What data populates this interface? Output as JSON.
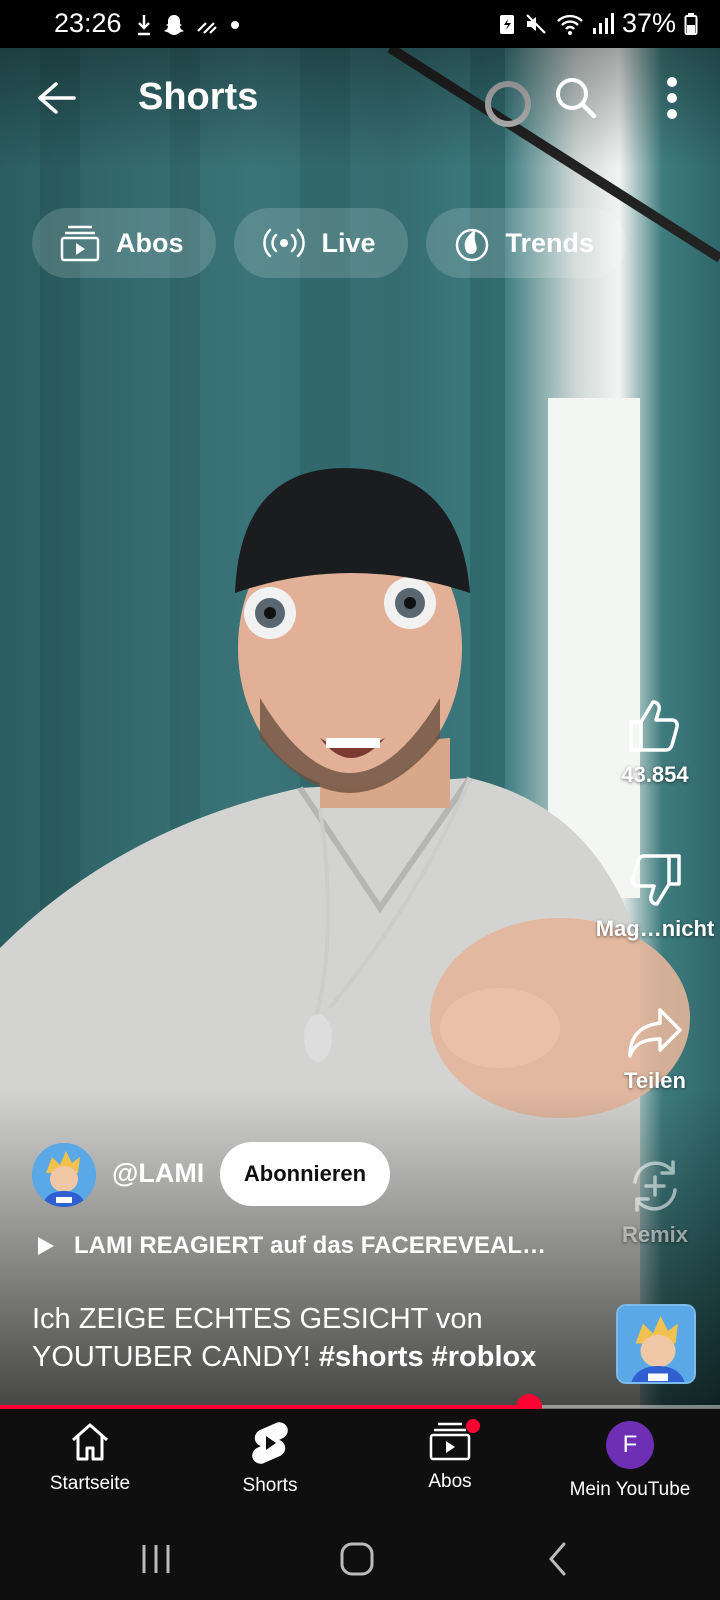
{
  "status_bar": {
    "time": "23:26",
    "battery_percent": "37%",
    "icons": [
      "download-icon",
      "snapchat-icon",
      "signal-strength-icon",
      "dot-icon",
      "battery-saver-icon",
      "mute-icon",
      "wifi-icon",
      "cell-signal-icon",
      "battery-icon"
    ]
  },
  "header": {
    "title": "Shorts"
  },
  "chips": [
    {
      "label": "Abos",
      "icon": "subscriptions-icon"
    },
    {
      "label": "Live",
      "icon": "live-icon"
    },
    {
      "label": "Trends",
      "icon": "trending-icon"
    }
  ],
  "actions": {
    "like_count": "43.854",
    "dislike_label": "Mag…nicht",
    "share_label": "Teilen",
    "remix_label": "Remix"
  },
  "channel": {
    "handle": "@LAMI",
    "subscribe_label": "Abonnieren"
  },
  "related_video": {
    "title": "LAMI REAGIERT auf das FACEREVEAL…"
  },
  "caption": {
    "text": "Ich ZEIGE ECHTES GESICHT von YOUTUBER CANDY! ",
    "hashtags": "#shorts #roblox"
  },
  "progress": {
    "fraction": 0.735
  },
  "bottom_nav": [
    {
      "label": "Startseite",
      "icon": "home-icon"
    },
    {
      "label": "Shorts",
      "icon": "shorts-icon"
    },
    {
      "label": "Abos",
      "icon": "subscriptions-icon"
    },
    {
      "label": "Mein YouTube",
      "icon": "account-avatar",
      "avatar_letter": "F"
    }
  ],
  "colors": {
    "accent": "#ff0033",
    "nav_background": "#0f0f0f",
    "account_avatar": "#6e2fb5"
  }
}
